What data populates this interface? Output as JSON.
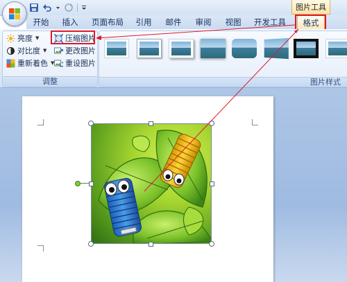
{
  "ribbon": {
    "context_header": "图片工具",
    "tabs": [
      {
        "label": "开始"
      },
      {
        "label": "插入"
      },
      {
        "label": "页面布局"
      },
      {
        "label": "引用"
      },
      {
        "label": "邮件"
      },
      {
        "label": "审阅"
      },
      {
        "label": "视图"
      },
      {
        "label": "开发工具"
      },
      {
        "label": "格式",
        "active": true
      }
    ],
    "adjust_group": {
      "label": "调整",
      "buttons": [
        {
          "label": "亮度",
          "icon": "brightness-icon",
          "dropdown": true
        },
        {
          "label": "对比度",
          "icon": "contrast-icon",
          "dropdown": true
        },
        {
          "label": "重新着色",
          "icon": "recolor-icon",
          "dropdown": true
        },
        {
          "label": "压缩图片",
          "icon": "compress-pictures-icon",
          "highlighted": true
        },
        {
          "label": "更改图片",
          "icon": "change-picture-icon"
        },
        {
          "label": "重设图片",
          "icon": "reset-picture-icon"
        }
      ]
    },
    "styles_group": {
      "label": "图片样式",
      "gallery": [
        "style-simple-frame",
        "style-thin-border",
        "style-drop-shadow",
        "style-soft-edge",
        "style-rounded",
        "style-perspective",
        "style-thick-black-frame"
      ]
    }
  },
  "quick_access": [
    "office-button",
    "save-icon",
    "undo-icon",
    "redo-icon",
    "customize-icon"
  ],
  "colors": {
    "highlight": "#e0182b",
    "ribbon_blue": "#d2e2f4",
    "workspace_blue": "#9fbbe1"
  },
  "document": {
    "image": "caterpillar-on-leaves",
    "selected": true
  }
}
